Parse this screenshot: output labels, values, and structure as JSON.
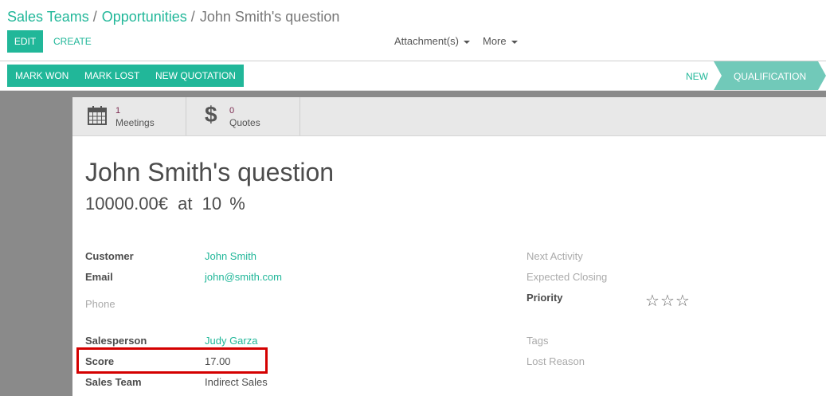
{
  "breadcrumb": {
    "items": [
      "Sales Teams",
      "Opportunities"
    ],
    "separator": "/",
    "current": "John Smith's question"
  },
  "toolbar": {
    "edit_label": "EDIT",
    "create_label": "CREATE",
    "attachments_label": "Attachment(s)",
    "more_label": "More"
  },
  "status_buttons": {
    "mark_won": "MARK WON",
    "mark_lost": "MARK LOST",
    "new_quotation": "NEW QUOTATION"
  },
  "stages": {
    "new": "NEW",
    "qualification": "QUALIFICATION",
    "active": "QUALIFICATION"
  },
  "smart_buttons": {
    "meetings": {
      "count": "1",
      "label": "Meetings",
      "icon": "calendar-icon"
    },
    "quotes": {
      "count": "0",
      "label": "Quotes",
      "icon": "dollar-icon"
    }
  },
  "opportunity": {
    "title": "John Smith's question",
    "amount": "10000.00€",
    "at_label": "at",
    "probability": "10",
    "percent_sign": "%"
  },
  "fields_left": {
    "customer": {
      "label": "Customer",
      "value": "John Smith"
    },
    "email": {
      "label": "Email",
      "value": "john@smith.com"
    },
    "phone": {
      "label": "Phone",
      "value": ""
    },
    "salesperson": {
      "label": "Salesperson",
      "value": "Judy Garza"
    },
    "score": {
      "label": "Score",
      "value": "17.00"
    },
    "sales_team": {
      "label": "Sales Team",
      "value": "Indirect Sales"
    }
  },
  "fields_right": {
    "next_activity": {
      "label": "Next Activity"
    },
    "expected_closing": {
      "label": "Expected Closing"
    },
    "priority": {
      "label": "Priority",
      "stars_filled": 0,
      "stars_total": 3
    },
    "tags": {
      "label": "Tags"
    },
    "lost_reason": {
      "label": "Lost Reason"
    }
  },
  "colors": {
    "accent": "#21b799",
    "stat_number": "#7c2a50",
    "highlight": "#d40000",
    "background": "#8a8a8a"
  }
}
